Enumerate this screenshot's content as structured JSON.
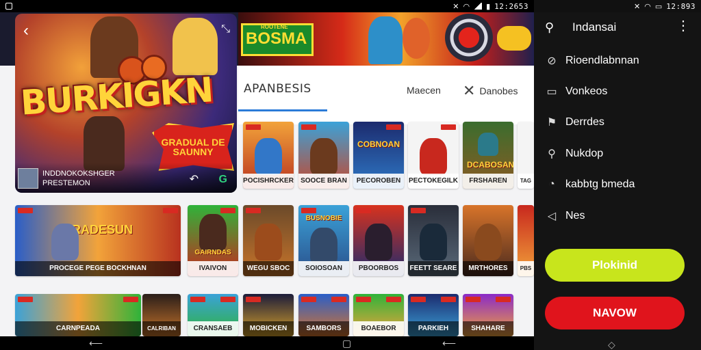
{
  "status_left": {
    "time": "",
    "icons": [
      "app-icon"
    ]
  },
  "status_right_main": {
    "time": "12:2653"
  },
  "status_right_side": {
    "time": "12:893"
  },
  "hero": {
    "title": "BURKIGKN",
    "badge": "GRADUAL DE SAUNNY",
    "subtitle_1": "INDDNOKOKSHGER",
    "subtitle_2": "PRESTEMON"
  },
  "banner": {
    "logo_text": "BOSMA",
    "logo_small": "ROOTENE"
  },
  "tabs": {
    "main": "APANBESIS",
    "second": "Maecen",
    "third": "Danobes"
  },
  "grid": {
    "row1": [
      {
        "caption": "POCISHRCKER"
      },
      {
        "caption": "SOOCE BRAN"
      },
      {
        "caption": "PECOROBEN",
        "banner": "COBNOAN"
      },
      {
        "caption": "PECTOKEGILK"
      },
      {
        "caption": "FRSHAREN",
        "banner": "DCABOSAN"
      },
      {
        "caption": "TAG"
      }
    ],
    "row2": [
      {
        "caption": "PROCEGE PEGE BOCKHNAN",
        "banner": "CRADESUN"
      },
      {
        "caption": "IVAIVON",
        "banner": "GAIRNDAS"
      },
      {
        "caption": "WEGU SBOC"
      },
      {
        "caption": "SOIOSOAN",
        "banner": "BUSNOBIE"
      },
      {
        "caption": "PBOORBOS"
      },
      {
        "caption": "FEETT SEARE"
      },
      {
        "caption": "MRTHORES"
      },
      {
        "caption": "PBS"
      }
    ],
    "row3": [
      {
        "caption": "CARNPEADA"
      },
      {
        "caption": "CALRIBAN"
      },
      {
        "caption": "CRANSAEB"
      },
      {
        "caption": "MOBICKEN"
      },
      {
        "caption": "SAMBORS"
      },
      {
        "caption": "BOAEBOR"
      },
      {
        "caption": "PARKIEH"
      },
      {
        "caption": "SHAHARE"
      }
    ]
  },
  "sidebar": {
    "title": "Indansai",
    "items": [
      {
        "label": "Rioendlabnnan",
        "icon": "block-icon"
      },
      {
        "label": "Vonkeos",
        "icon": "monitor-icon"
      },
      {
        "label": "Derrdes",
        "icon": "flag-icon"
      },
      {
        "label": "Nukdop",
        "icon": "search-icon"
      },
      {
        "label": "kabbtg bmeda",
        "icon": "gauge-icon"
      },
      {
        "label": "Nes",
        "icon": "send-icon"
      }
    ],
    "btn_primary": "Plokinid",
    "btn_secondary": "NAVOW"
  },
  "colors": {
    "accent_green": "#c8e51c",
    "accent_red": "#e0141c",
    "tab_underline": "#2b7bd8"
  }
}
